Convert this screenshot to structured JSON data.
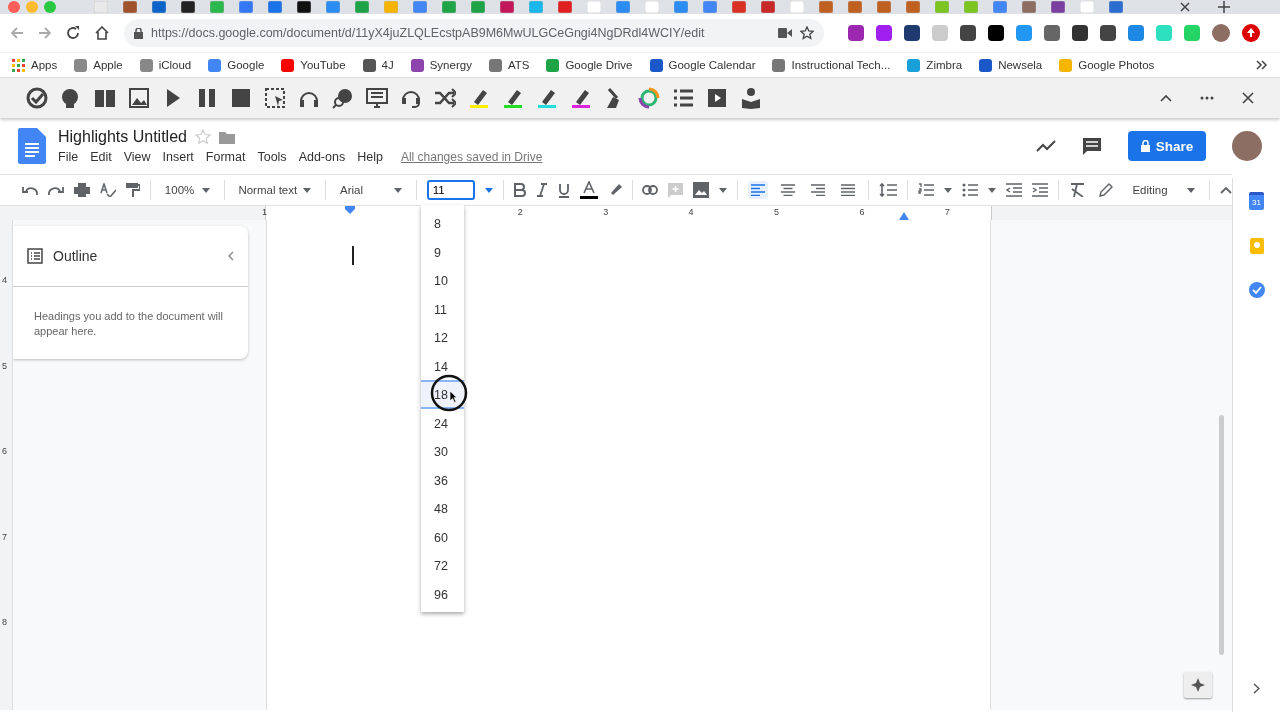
{
  "address_bar": {
    "url": "https://docs.google.com/document/d/11yX4juZLQLEcstpAB9M6MwULGCeGngi4NgDRdl4WCIY/edit"
  },
  "bookmarks": [
    {
      "label": "Apps"
    },
    {
      "label": "Apple"
    },
    {
      "label": "iCloud"
    },
    {
      "label": "Google"
    },
    {
      "label": "YouTube"
    },
    {
      "label": "4J"
    },
    {
      "label": "Synergy"
    },
    {
      "label": "ATS"
    },
    {
      "label": "Google Drive"
    },
    {
      "label": "Google Calendar"
    },
    {
      "label": "Instructional Tech..."
    },
    {
      "label": "Zimbra"
    },
    {
      "label": "Newsela"
    },
    {
      "label": "Google Photos"
    }
  ],
  "document": {
    "title": "Highlights Untitled",
    "menus": [
      "File",
      "Edit",
      "View",
      "Insert",
      "Format",
      "Tools",
      "Add-ons",
      "Help"
    ],
    "save_status": "All changes saved in Drive",
    "share": "Share"
  },
  "toolbar": {
    "zoom": "100%",
    "style": "Normal text",
    "font": "Arial",
    "font_size": "11",
    "mode": "Editing",
    "align_buttons": [
      {
        "selected": true
      },
      {
        "selected": false
      },
      {
        "selected": false
      },
      {
        "selected": false
      }
    ]
  },
  "ruler": {
    "labels": [
      "1",
      "2",
      "3",
      "4",
      "5",
      "6",
      "7"
    ]
  },
  "vertical_ruler": {
    "labels": [
      "4",
      "5",
      "6",
      "7",
      "8"
    ]
  },
  "outline": {
    "title": "Outline",
    "hint": "Headings you add to the document will appear here."
  },
  "font_size_menu": [
    {
      "label": "8",
      "selected": false
    },
    {
      "label": "9",
      "selected": false
    },
    {
      "label": "10",
      "selected": false
    },
    {
      "label": "11",
      "selected": false
    },
    {
      "label": "12",
      "selected": false
    },
    {
      "label": "14",
      "selected": false
    },
    {
      "label": "18",
      "selected": true
    },
    {
      "label": "24",
      "selected": false
    },
    {
      "label": "30",
      "selected": false
    },
    {
      "label": "36",
      "selected": false
    },
    {
      "label": "48",
      "selected": false
    },
    {
      "label": "60",
      "selected": false
    },
    {
      "label": "72",
      "selected": false
    },
    {
      "label": "96",
      "selected": false
    }
  ],
  "side_panel": {
    "calendar_day": "31"
  }
}
